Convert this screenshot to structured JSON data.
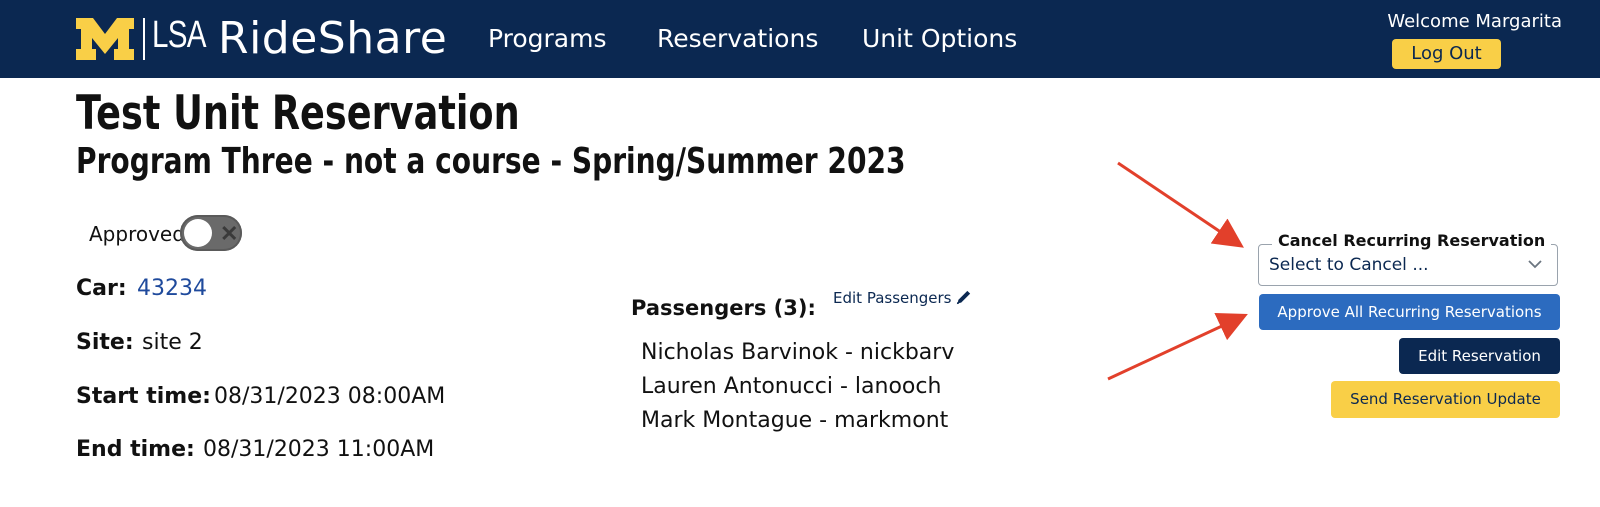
{
  "header": {
    "logo_text": "LSA",
    "brand": "RideShare",
    "nav": [
      {
        "label": "Programs"
      },
      {
        "label": "Reservations"
      },
      {
        "label": "Unit Options"
      }
    ],
    "welcome": "Welcome Margarita",
    "logout_label": "Log Out"
  },
  "page": {
    "title": "Test Unit Reservation",
    "subtitle": "Program Three - not a course - Spring/Summer 2023",
    "approved_label": "Approved",
    "approved_state": false
  },
  "details": {
    "car_label": "Car:",
    "car_value": "43234",
    "site_label": "Site:",
    "site_value": "site 2",
    "start_label": "Start time:",
    "start_value": "08/31/2023 08:00AM",
    "end_label": "End time:",
    "end_value": "08/31/2023 11:00AM"
  },
  "passengers": {
    "title": "Passengers (3):",
    "edit_label": "Edit Passengers",
    "list": [
      "Nicholas Barvinok - nickbarv",
      "Lauren Antonucci - lanooch",
      "Mark Montague - markmont"
    ]
  },
  "actions": {
    "cancel_recurring_legend": "Cancel Recurring Reservation",
    "cancel_select_value": "Select to Cancel ...",
    "approve_all_label": "Approve All Recurring Reservations",
    "edit_reservation_label": "Edit Reservation",
    "send_update_label": "Send Reservation Update"
  },
  "colors": {
    "header_bg": "#0b2851",
    "accent_yellow": "#f9cf47",
    "button_blue": "#2c6bbf",
    "annotation_red": "#e2402b"
  }
}
